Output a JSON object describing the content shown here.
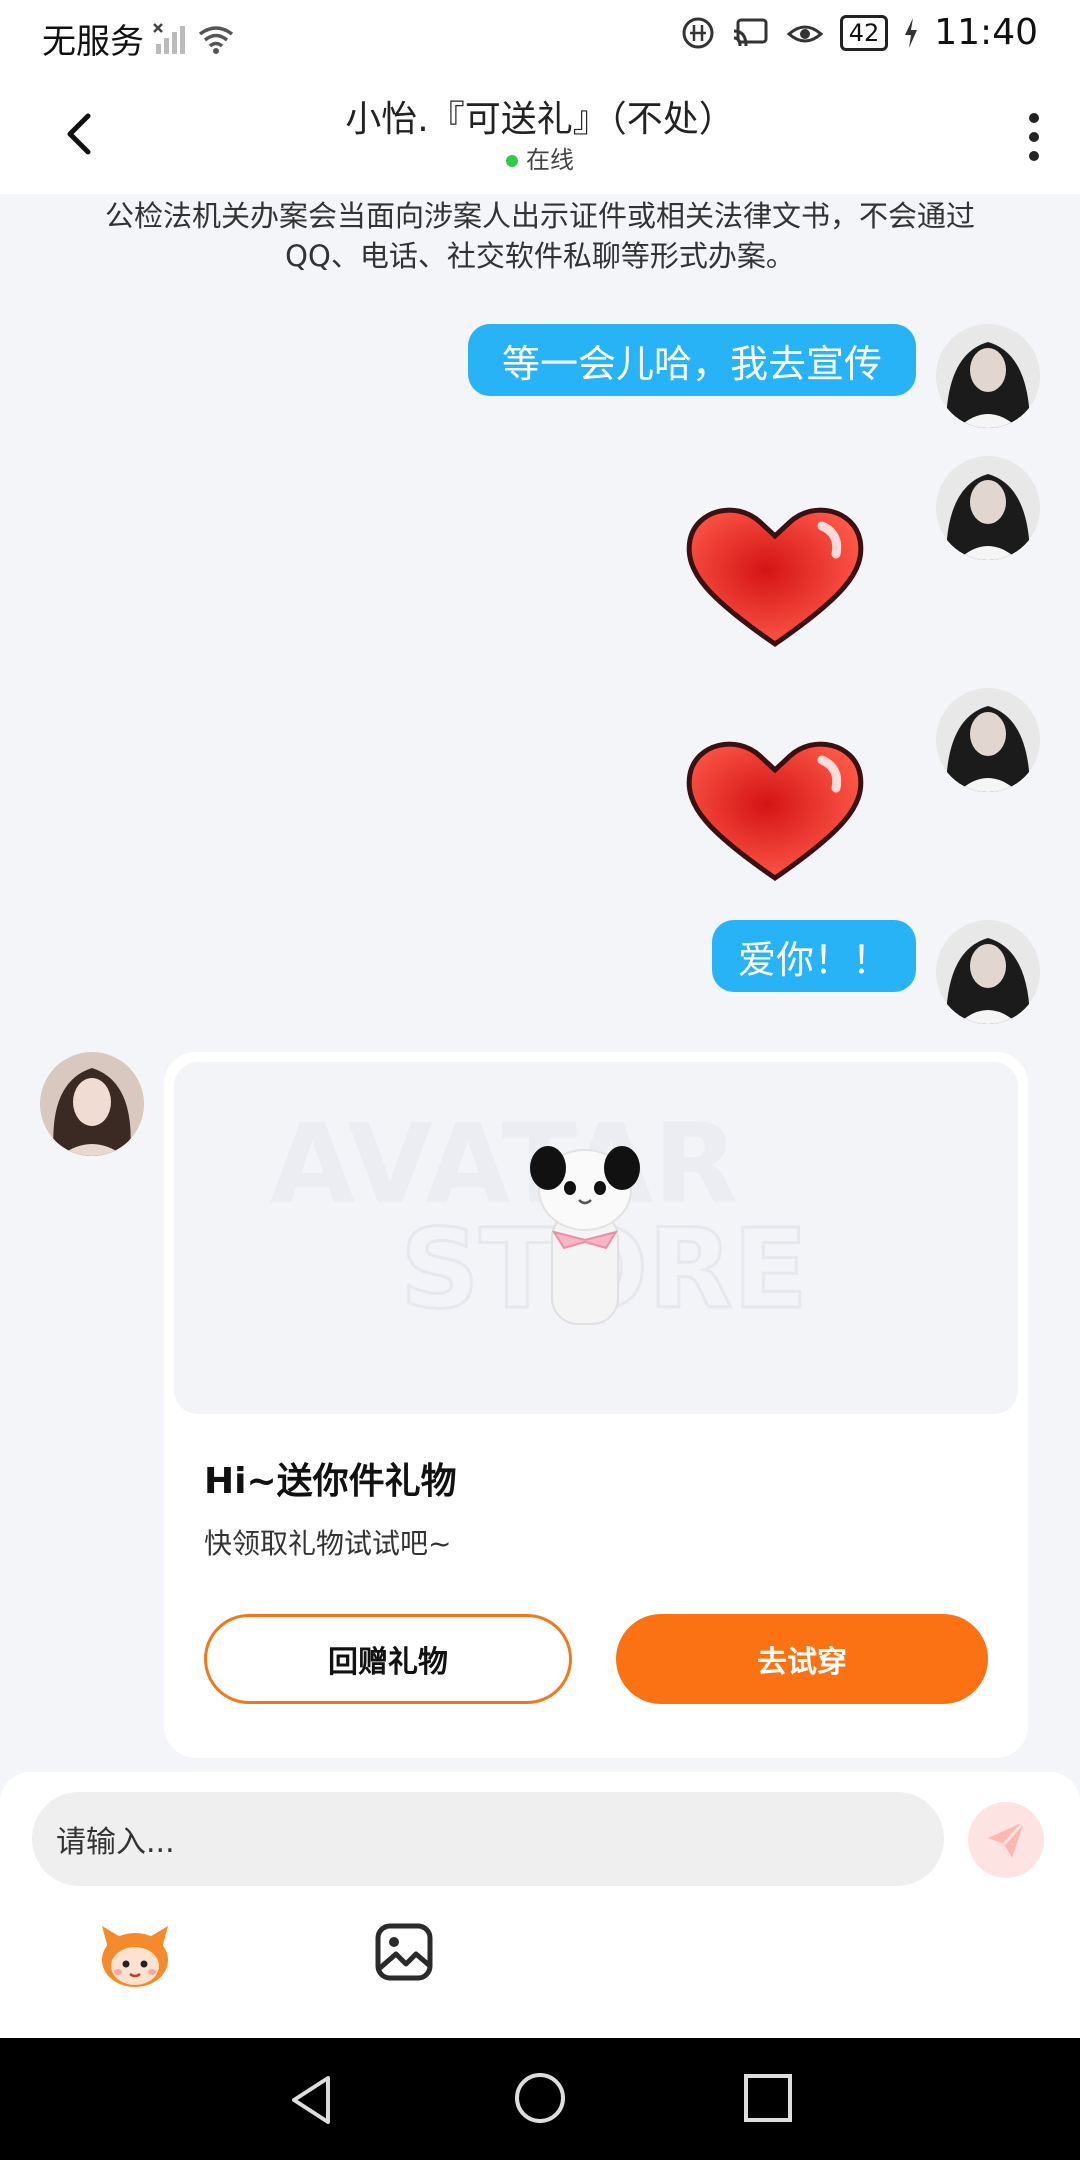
{
  "status_bar": {
    "carrier": "无服务",
    "battery": "42",
    "time": "11:40"
  },
  "header": {
    "title": "小怡.『可送礼』（不处）",
    "status": "在线"
  },
  "notice": "公检法机关办案会当面向涉案人出示证件或相关法律文书，不会通过QQ、电话、社交软件私聊等形式办案。",
  "messages": [
    {
      "from": "me",
      "type": "text",
      "text": "等一会儿哈，我去宣传"
    },
    {
      "from": "me",
      "type": "sticker",
      "icon": "heart-sticker"
    },
    {
      "from": "me",
      "type": "sticker",
      "icon": "heart-sticker"
    },
    {
      "from": "me",
      "type": "text",
      "text": "爱你！！"
    }
  ],
  "gift_card": {
    "watermark_line1": "AVATAR",
    "watermark_line2": "STORE",
    "title": "Hi~送你件礼物",
    "subtitle": "快领取礼物试试吧~",
    "return_gift_label": "回赠礼物",
    "try_on_label": "去试穿"
  },
  "composer": {
    "placeholder": "请输入..."
  },
  "colors": {
    "bubble": "#27b3f5",
    "accent": "#fa7214",
    "online": "#2ecc48"
  }
}
